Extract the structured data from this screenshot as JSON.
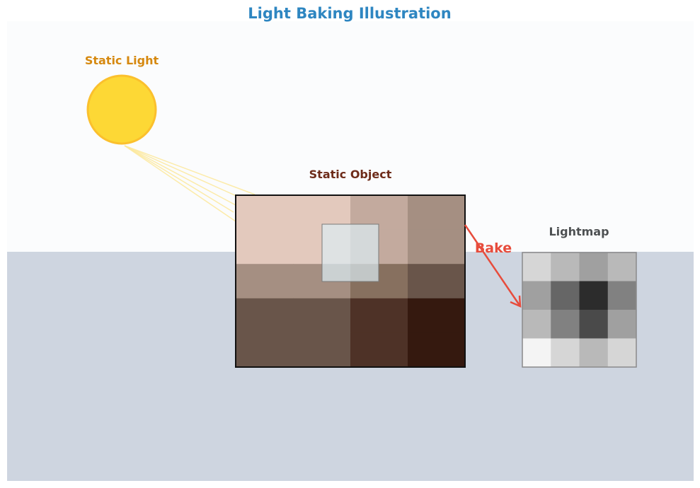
{
  "title": "Light Baking Illustration",
  "light": {
    "label": "Static Light",
    "color": "#fdd835",
    "stroke": "#fbc02d",
    "label_color": "#d68910"
  },
  "object": {
    "label": "Static Object",
    "label_color": "#6e2c1a",
    "shading_grid": [
      [
        "#e3c9bd",
        "#e3c9bd",
        "#c3aa9e",
        "#a58f82"
      ],
      [
        "#e3c9bd",
        "#e3c9bd",
        "#c3aa9e",
        "#a58f82"
      ],
      [
        "#a58f82",
        "#a58f82",
        "#87705f",
        "#69554a"
      ],
      [
        "#69554a",
        "#69554a",
        "#4e3227",
        "#35190f"
      ],
      [
        "#69554a",
        "#69554a",
        "#4e3227",
        "#35190f"
      ]
    ]
  },
  "arrow": {
    "label": "Bake",
    "color": "#e74c3c"
  },
  "lightmap": {
    "label": "Lightmap",
    "label_color": "#4d5052",
    "grid": [
      [
        "#d6d6d6",
        "#b9b9b9",
        "#a0a0a0",
        "#b9b9b9"
      ],
      [
        "#a0a0a0",
        "#666666",
        "#2c2c2c",
        "#818181"
      ],
      [
        "#b9b9b9",
        "#818181",
        "#4a4a4a",
        "#a0a0a0"
      ],
      [
        "#f4f4f4",
        "#d6d6d6",
        "#b9b9b9",
        "#d6d6d6"
      ]
    ]
  },
  "colors": {
    "title": "#2e86c1",
    "sky": "#fbfcfd",
    "floor": "#ced5e0"
  }
}
